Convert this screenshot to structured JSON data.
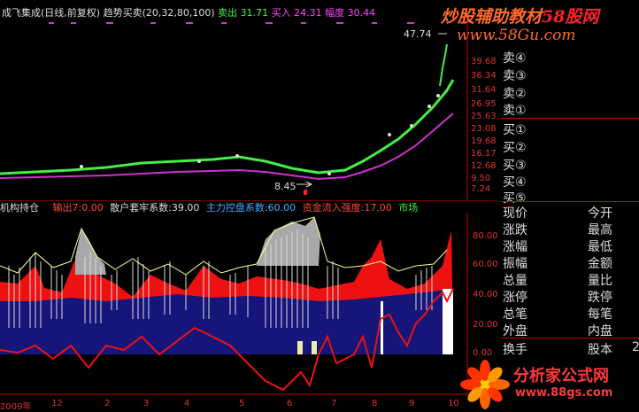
{
  "header": {
    "title": "成飞集成(日线,前复权)",
    "indicator": "趋势买卖(20,32,80,100)",
    "sell_label": "卖出",
    "sell_value": "31.71",
    "buy_label": "买入",
    "buy_value": "24.31",
    "range_label": "幅度",
    "range_value": "30.44"
  },
  "watermark": {
    "line1": "炒股辅助教材",
    "brand": "58股网",
    "line2": "www.58Gu.com"
  },
  "main_chart": {
    "high_marker": "47.74",
    "low_marker": "8.45",
    "price_axis": [
      "39.68",
      "36.34",
      "31.64",
      "26.95",
      "25.63",
      "23.08",
      "19.68",
      "16.17",
      "12.68",
      "9.50",
      "7.24"
    ],
    "colors": {
      "green": "#44ee44",
      "magenta": "#d030d0",
      "red": "#ff2020"
    }
  },
  "sub_chart": {
    "name": "机构持仓",
    "out_label": "输出7:0.00",
    "retail_label": "散户套牢系数:39.00",
    "main_label": "主力控盘系数:60.00",
    "flow_label": "资金流入强度:17.00",
    "market_label": "市场",
    "axis": [
      "80.00",
      "60.00",
      "40.00",
      "20.00",
      "0.00"
    ]
  },
  "bottom_axis": [
    "2009年",
    "12",
    "2",
    "3",
    "4",
    "5",
    "6",
    "7",
    "8",
    "9",
    "10"
  ],
  "order_book": [
    {
      "label": "卖④"
    },
    {
      "label": "卖③"
    },
    {
      "label": "卖②"
    },
    {
      "label": "卖①"
    },
    {
      "label": "买①"
    },
    {
      "label": "买②"
    },
    {
      "label": "买③"
    },
    {
      "label": "买④"
    },
    {
      "label": "买⑤"
    }
  ],
  "quote_fields": [
    [
      "现价",
      "今开"
    ],
    [
      "涨跌",
      "最高"
    ],
    [
      "涨幅",
      "最低"
    ],
    [
      "振幅",
      "金额"
    ],
    [
      "总量",
      "量比"
    ],
    [
      "涨停",
      "跌停"
    ],
    [
      "总笔",
      "每笔"
    ],
    [
      "外盘",
      "内盘"
    ]
  ],
  "footer_fields": {
    "turnover": "换手",
    "equity": "股本",
    "equity_val": "2"
  },
  "logo": {
    "text": "分析家公式网",
    "url": "www.88gs.com"
  }
}
